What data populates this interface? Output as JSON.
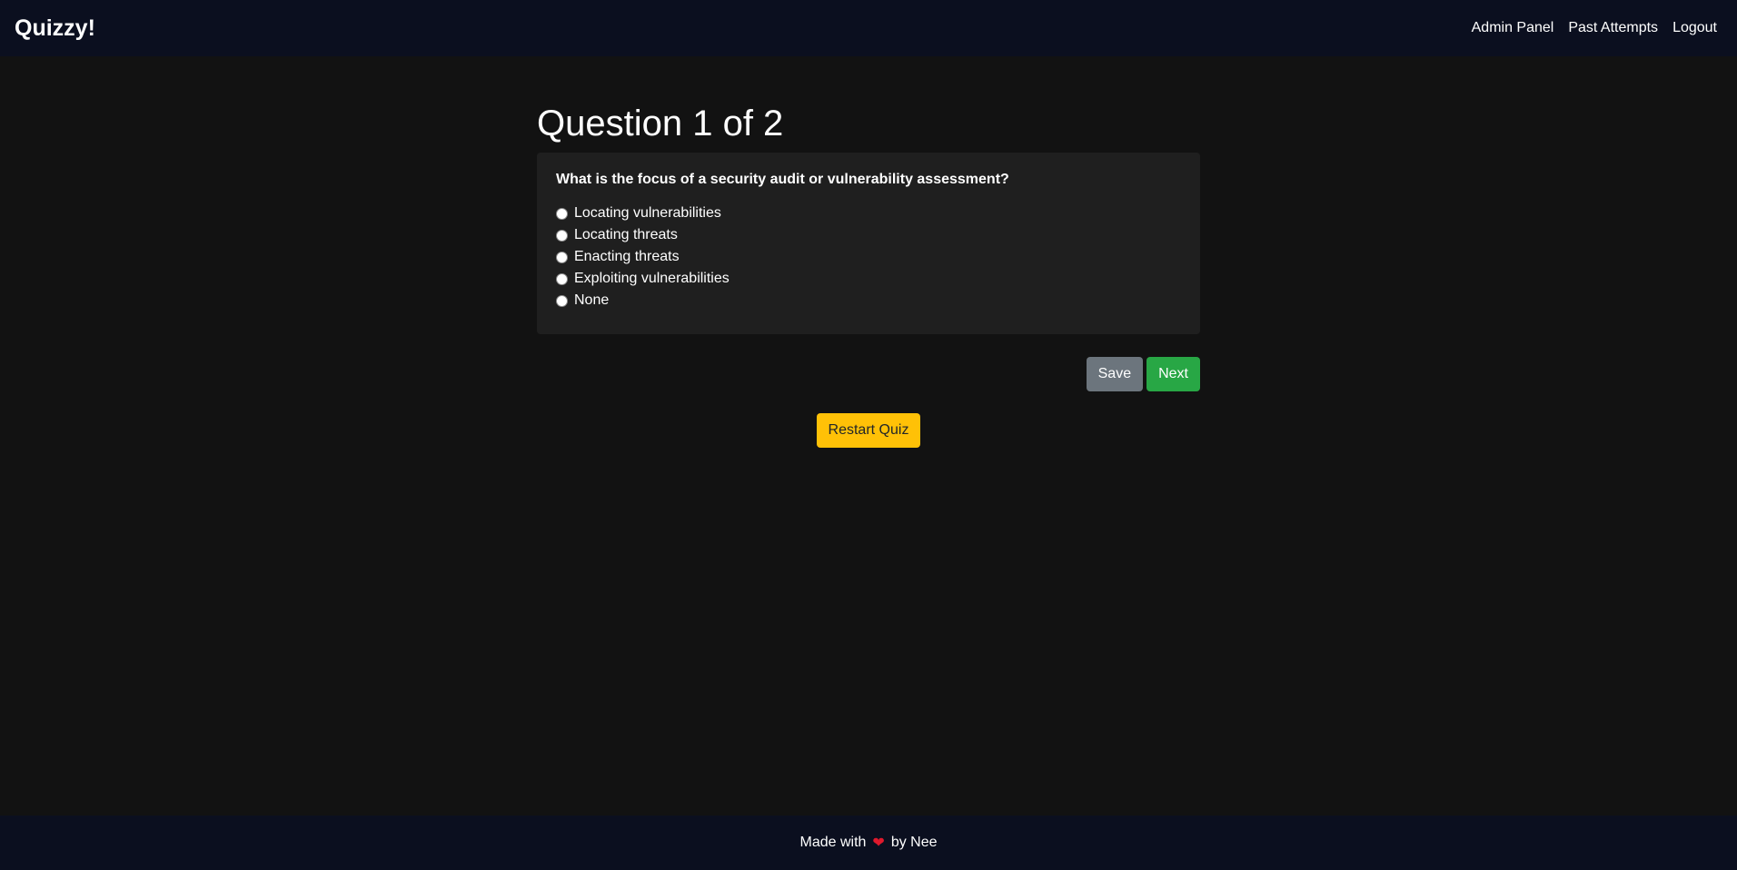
{
  "navbar": {
    "brand": "Quizzy!",
    "links": [
      "Admin Panel",
      "Past Attempts",
      "Logout"
    ]
  },
  "quiz": {
    "title": "Question 1 of 2",
    "question": "What is the focus of a security audit or vulnerability assessment?",
    "options": [
      "Locating vulnerabilities",
      "Locating threats",
      "Enacting threats",
      "Exploiting vulnerabilities",
      "None"
    ],
    "save_label": "Save",
    "next_label": "Next",
    "restart_label": "Restart Quiz"
  },
  "footer": {
    "made_with": "Made with",
    "heart_icon": "heart-icon",
    "by": "by Nee"
  },
  "colors": {
    "navbar_bg": "#0b0f1f",
    "page_bg": "#121212",
    "card_bg": "#1f1f1f",
    "save": "#6c757d",
    "next": "#28a745",
    "restart": "#ffc107",
    "heart": "#e0192c"
  }
}
